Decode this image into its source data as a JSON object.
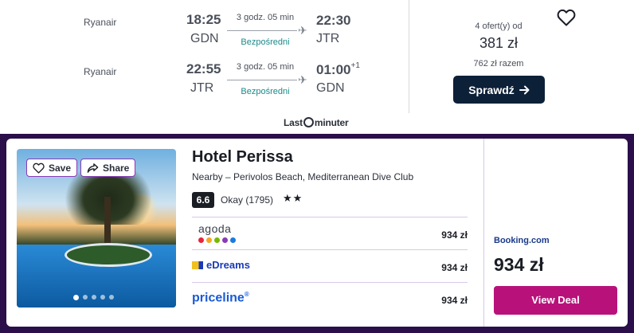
{
  "flight": {
    "legs": [
      {
        "airline": "Ryanair",
        "dep_time": "18:25",
        "dep_airport": "GDN",
        "duration": "3 godz. 05 min",
        "stops": "Bezpośredni",
        "arr_time": "22:30",
        "arr_day_offset": "",
        "arr_airport": "JTR"
      },
      {
        "airline": "Ryanair",
        "dep_time": "22:55",
        "dep_airport": "JTR",
        "duration": "3 godz. 05 min",
        "stops": "Bezpośredni",
        "arr_time": "01:00",
        "arr_day_offset": "+1",
        "arr_airport": "GDN"
      }
    ],
    "offers_label": "4 ofert(y) od",
    "price": "381 zł",
    "total": "762 zł razem",
    "check_button": "Sprawdź",
    "provider_prefix": "Last",
    "provider_suffix": "minuter",
    "icons": {
      "favorite": "heart-outline-icon",
      "plane": "plane-icon",
      "arrow": "arrow-right-icon"
    }
  },
  "hotel": {
    "save_label": "Save",
    "share_label": "Share",
    "name": "Hotel Perissa",
    "nearby": "Nearby – Perivolos Beach, Mediterranean Dive Club",
    "rating_score": "6.6",
    "rating_text": "Okay (1795)",
    "stars": "★★",
    "star_count": 2,
    "photo_count": 5,
    "active_photo": 1,
    "providers": [
      {
        "name": "agoda",
        "price": "934 zł",
        "dot_colors": [
          "#e8243c",
          "#f5a623",
          "#7ab800",
          "#8a3ab8",
          "#1a7ae0"
        ]
      },
      {
        "name": "eDreams",
        "price": "934 zł"
      },
      {
        "name": "priceline",
        "mark": "®",
        "price": "934 zł"
      }
    ],
    "best_provider": "Booking.com",
    "best_price": "934 zł",
    "view_deal": "View Deal",
    "icons": {
      "save": "heart-outline-icon",
      "share": "share-icon"
    }
  },
  "colors": {
    "accent_button_dark": "#0c2038",
    "direct_teal": "#1a8a8a",
    "hotel_frame": "#2a0f4a",
    "view_deal": "#b8127a",
    "priceline_blue": "#1a5ad6",
    "edreams_blue": "#1a3ab8",
    "booking_blue": "#1a3a8a"
  }
}
